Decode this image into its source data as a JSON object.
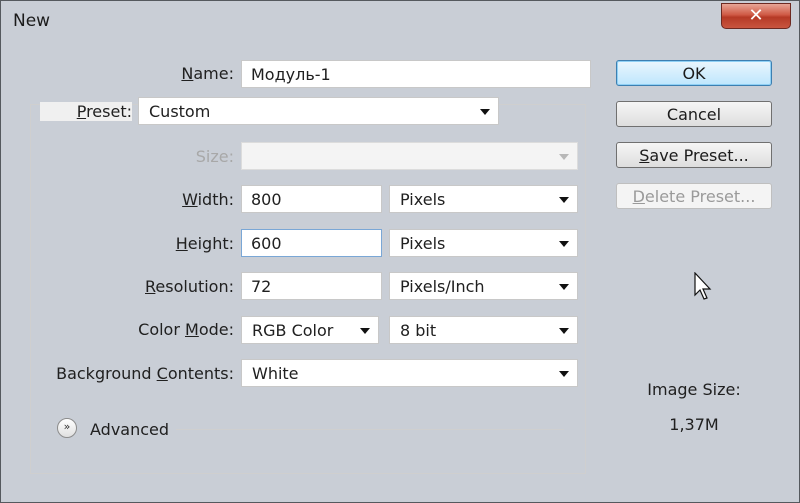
{
  "window": {
    "title": "New",
    "close_glyph": "✕"
  },
  "form": {
    "name": {
      "label": "Name:",
      "value": "Модуль-1"
    },
    "preset": {
      "label": "Preset:",
      "value": "Custom"
    },
    "size": {
      "label": "Size:",
      "value": ""
    },
    "width": {
      "label": "Width:",
      "value": "800",
      "unit": "Pixels"
    },
    "height": {
      "label": "Height:",
      "value": "600",
      "unit": "Pixels"
    },
    "resolution": {
      "label": "Resolution:",
      "value": "72",
      "unit": "Pixels/Inch"
    },
    "color_mode": {
      "label": "Color Mode:",
      "value": "RGB Color",
      "depth": "8 bit"
    },
    "background": {
      "label": "Background Contents:",
      "value": "White"
    },
    "advanced": {
      "label": "Advanced",
      "icon": "chevron-double-down-icon"
    }
  },
  "buttons": {
    "ok": "OK",
    "cancel": "Cancel",
    "save_preset": "Save Preset...",
    "delete_preset": "Delete Preset..."
  },
  "image_size": {
    "label": "Image Size:",
    "value": "1,37M"
  }
}
